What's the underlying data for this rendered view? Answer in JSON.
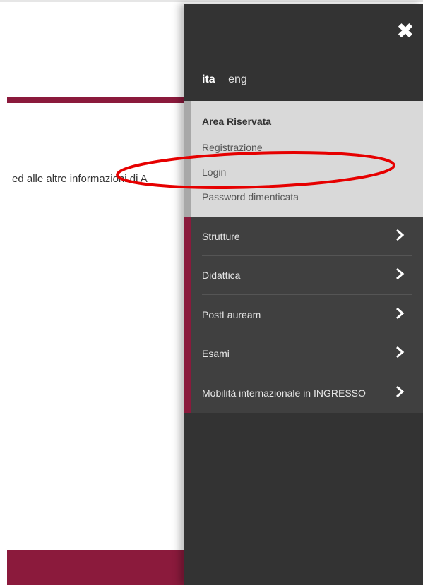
{
  "background": {
    "body_text": "ed alle altre informazioni di A"
  },
  "menu": {
    "languages": [
      {
        "label": "ita",
        "active": true
      },
      {
        "label": "eng",
        "active": false
      }
    ],
    "area_riservata": {
      "title": "Area Riservata",
      "links": [
        "Registrazione",
        "Login",
        "Password dimenticata"
      ]
    },
    "nav_items": [
      {
        "label": "Strutture"
      },
      {
        "label": "Didattica"
      },
      {
        "label": "PostLauream"
      },
      {
        "label": "Esami"
      },
      {
        "label": "Mobilità internazionale in INGRESSO"
      }
    ],
    "close_icon": "close-x-icon",
    "chevron_icon": "chevron-right-icon"
  },
  "annotation": {
    "shape": "ellipse",
    "color": "#e60000",
    "highlights": "Login"
  },
  "colors": {
    "brand_maroon": "#8b1a3c",
    "drawer_bg": "#333333",
    "area_bg": "#d9d9d9"
  }
}
